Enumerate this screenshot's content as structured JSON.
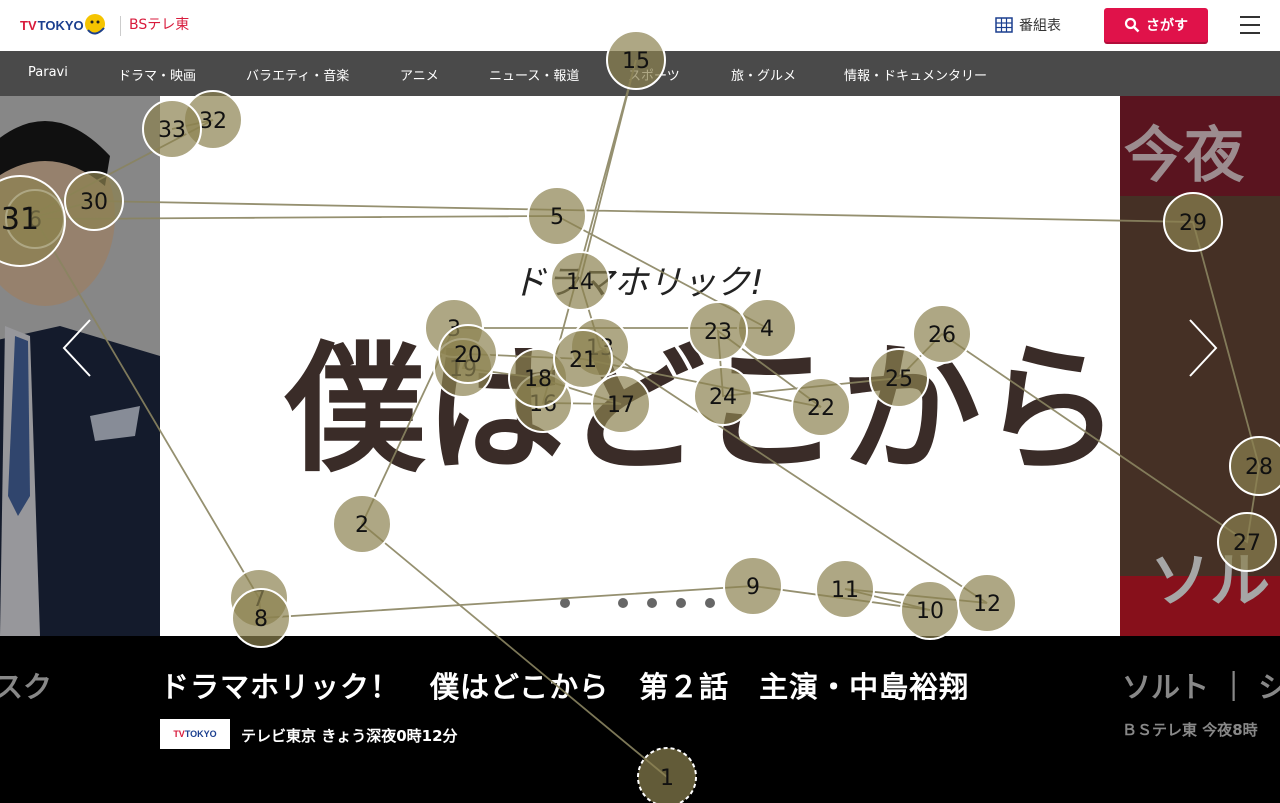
{
  "header": {
    "logo_tv": "TV",
    "logo_tokyo": "TOKYO",
    "logo_bs": "BSテレ東",
    "schedule_label": "番組表",
    "search_label": "さがす"
  },
  "nav": {
    "items": [
      "Paravi",
      "ドラマ・映画",
      "バラエティ・音楽",
      "アニメ",
      "ニュース・報道",
      "スポーツ",
      "旅・グルメ",
      "情報・ドキュメンタリー"
    ]
  },
  "hero": {
    "main_title_small": "ドラマホリック!",
    "main_title_big": "僕はどこから",
    "right_text": "今夜",
    "right_text2": "ソル"
  },
  "caption": {
    "left": "スク",
    "title": "ドラマホリック！　僕はどこから　第２話　主演・中島裕翔",
    "channel_tv": "TV",
    "channel_tokyo": "TOKYO",
    "time": "テレビ東京 きょう深夜0時12分",
    "right_title": "ソルト ｜ シ",
    "right_time": "ＢＳテレ東 今夜8時"
  },
  "overlay": {
    "labels": [
      "1",
      "2",
      "3",
      "4",
      "5",
      "6",
      "7",
      "8",
      "9",
      "10",
      "11",
      "12",
      "13",
      "14",
      "15",
      "16",
      "17",
      "18",
      "19",
      "20",
      "21",
      "22",
      "23",
      "24",
      "25",
      "26",
      "27",
      "28",
      "29",
      "30",
      "31",
      "32",
      "33"
    ]
  }
}
